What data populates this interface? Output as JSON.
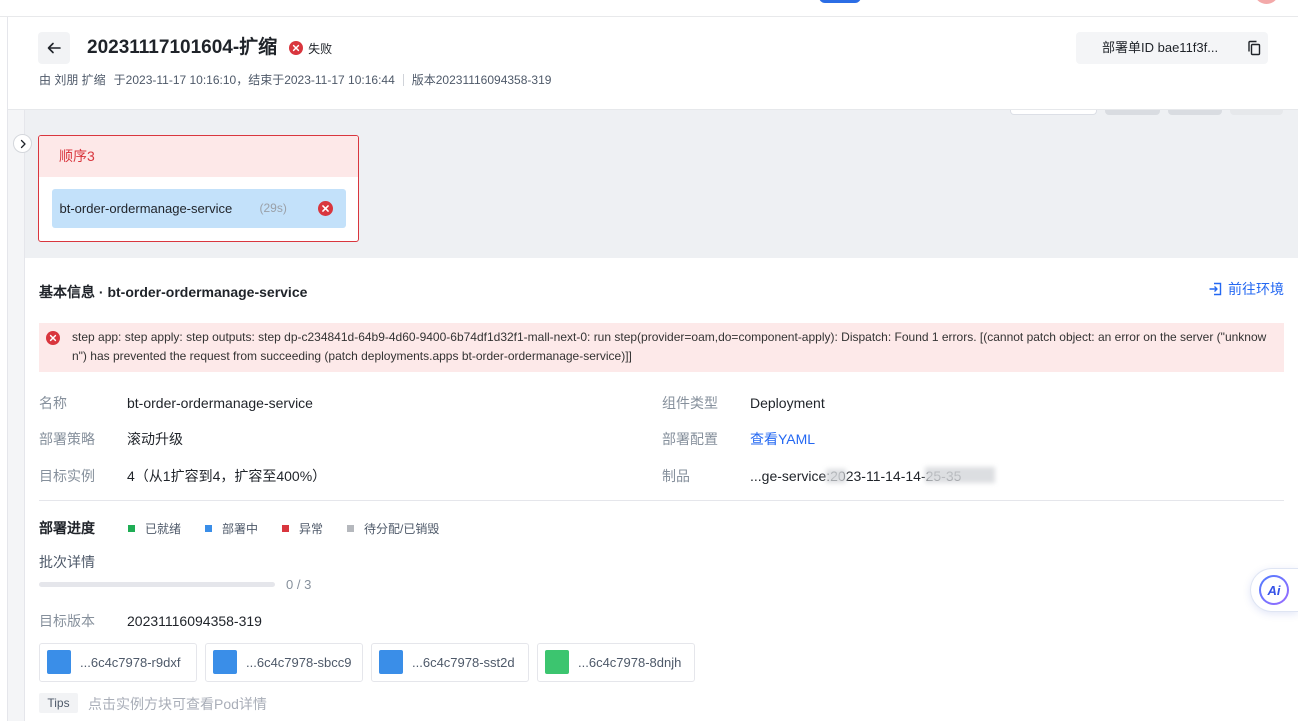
{
  "colors": {
    "primary": "#2468f2",
    "danger": "#d9363e",
    "success": "#1fad55",
    "info": "#3a8ee8",
    "muted": "#b5b8bd"
  },
  "header": {
    "back_icon": "arrow-left-icon",
    "title": "20231117101604-扩缩",
    "status": {
      "label": "失败",
      "icon": "x-circle-icon",
      "color": "#d9363e"
    },
    "meta": {
      "operator": "由 刘朋 扩缩",
      "time": "于2023-11-17 10:16:10，结束于2023-11-17 10:16:44",
      "version": "版本20231116094358-319"
    },
    "deploy_id": {
      "text": "部署单ID bae11f3f...",
      "icon": "copy-icon"
    }
  },
  "pipeline": {
    "expand_icon": "chevron-right-icon",
    "stages": [
      {
        "title": "顺序3",
        "color": "#d9363e",
        "tasks": [
          {
            "name": "bt-order-ordermanage-service",
            "duration": "(29s)",
            "status_icon": "x-circle-icon"
          }
        ]
      }
    ]
  },
  "detail": {
    "title": "基本信息 · bt-order-ordermanage-service",
    "goto_env": {
      "label": "前往环境",
      "icon": "enter-icon"
    },
    "error": {
      "icon": "x-circle-icon",
      "message": "step app: step apply: step outputs: step dp-c234841d-64b9-4d60-9400-6b74df1d32f1-mall-next-0: run step(provider=oam,do=component-apply): Dispatch: Found 1 errors. [(cannot patch object: an error on the server (\"unknown\") has prevented the request from succeeding (patch deployments.apps bt-order-ordermanage-service)]]"
    },
    "fields": [
      {
        "label": "名称",
        "value": "bt-order-ordermanage-service"
      },
      {
        "label": "组件类型",
        "value": "Deployment"
      },
      {
        "label": "部署策略",
        "value": "滚动升级"
      },
      {
        "label": "部署配置",
        "value": "查看YAML",
        "link": true
      },
      {
        "label": "目标实例",
        "value": "4（从1扩容到4，扩容至400%）"
      },
      {
        "label": "制品",
        "value": "...ge-service:2023-11-14-14-25-35"
      }
    ],
    "progress": {
      "title": "部署进度",
      "legend": [
        {
          "label": "已就绪",
          "color": "#1fad55"
        },
        {
          "label": "部署中",
          "color": "#3a8ee8"
        },
        {
          "label": "异常",
          "color": "#d9363e"
        },
        {
          "label": "待分配/已销毁",
          "color": "#b5b8bd"
        }
      ],
      "batch": {
        "label": "批次详情",
        "fill_fraction": 0,
        "text": "0 / 3"
      },
      "target_version": {
        "label": "目标版本",
        "value": "20231116094358-319"
      },
      "instances": [
        {
          "name": "...6c4c7978-r9dxf",
          "color": "#3a8ee8"
        },
        {
          "name": "...6c4c7978-sbcc9",
          "color": "#3a8ee8"
        },
        {
          "name": "...6c4c7978-sst2d",
          "color": "#3a8ee8"
        },
        {
          "name": "...6c4c7978-8dnjh",
          "color": "#3cc56f"
        }
      ],
      "tips": {
        "tag": "Tips",
        "text": "点击实例方块可查看Pod详情"
      }
    }
  },
  "ai_assistant": {
    "label": "Ai",
    "icon": "ai-assistant-icon"
  }
}
